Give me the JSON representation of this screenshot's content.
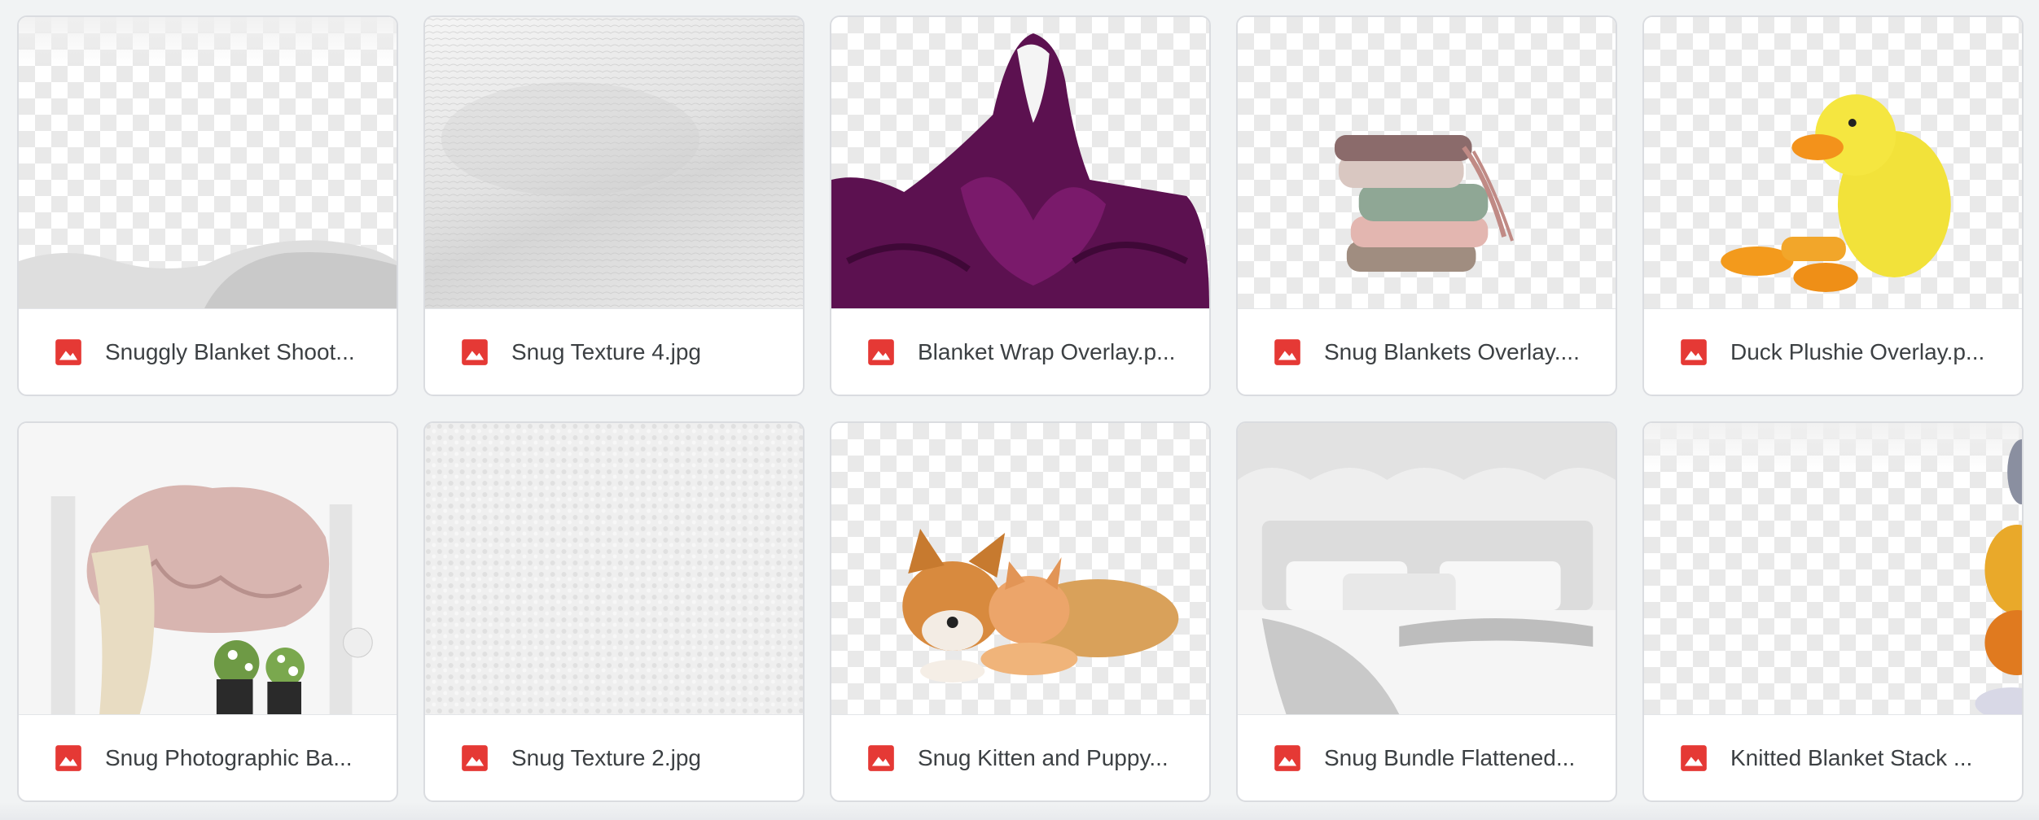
{
  "files": [
    {
      "name": "Snuggly Blanket Shoot...",
      "icon": "image-file-icon"
    },
    {
      "name": "Snug Texture 4.jpg",
      "icon": "image-file-icon"
    },
    {
      "name": "Blanket Wrap Overlay.p...",
      "icon": "image-file-icon"
    },
    {
      "name": "Snug Blankets Overlay....",
      "icon": "image-file-icon"
    },
    {
      "name": "Duck Plushie Overlay.p...",
      "icon": "image-file-icon"
    },
    {
      "name": "Snug Photographic Ba...",
      "icon": "image-file-icon"
    },
    {
      "name": "Snug Texture 2.jpg",
      "icon": "image-file-icon"
    },
    {
      "name": "Snug Kitten and Puppy...",
      "icon": "image-file-icon"
    },
    {
      "name": "Snug Bundle Flattened...",
      "icon": "image-file-icon"
    },
    {
      "name": "Knitted Blanket Stack ...",
      "icon": "image-file-icon"
    }
  ],
  "colors": {
    "image_icon": "#e53935",
    "card_border": "#dadce0",
    "text": "#3c4043"
  }
}
